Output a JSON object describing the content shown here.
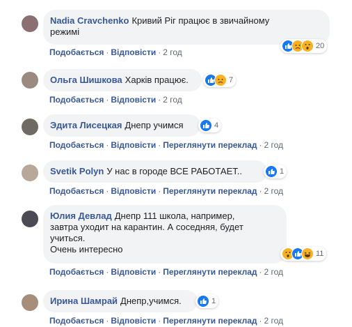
{
  "colors": {
    "link": "#385898",
    "bubble": "#f2f3f5",
    "meta": "#606770",
    "like": "#1877f2",
    "emoji": "#f7b125"
  },
  "actions": {
    "like": "Подобається",
    "reply": "Відповісти",
    "translate": "Переглянути переклад",
    "separator": "·"
  },
  "comments": [
    {
      "author": "Nadia Cravchenko",
      "text_line1": "Кривий Ріг працює в звичайному",
      "text_line2": "режимі",
      "reactions": [
        "like",
        "sad",
        "wow"
      ],
      "count": "20",
      "time": "2 год"
    },
    {
      "author": "Ольга Шишкова",
      "text": "Харків працює.",
      "reactions": [
        "like",
        "sad"
      ],
      "count": "7",
      "time": "2 год"
    },
    {
      "author": "Эдита Лисецкая",
      "text": "Днепр учимся",
      "reactions": [
        "like"
      ],
      "count": "4",
      "time": "2 год"
    },
    {
      "author": "Svetik Polyn",
      "text": "У нас в городе ВСЕ РАБОТАЕТ..",
      "reactions": [
        "like"
      ],
      "count": "1",
      "time": "2 год"
    },
    {
      "author": "Юлия Девлад",
      "text_line1": "Днепр 111 школа, например,",
      "text_line2": "завтра уходит на карантин. А соседняя, будет",
      "text_line3": "учиться.",
      "text_line4": "Очень интересно",
      "reactions": [
        "wow",
        "like",
        "haha"
      ],
      "count": "11",
      "time": "2 год"
    },
    {
      "author": "Ирина Шамрай",
      "text": "Днепр,учимся.",
      "reactions": [
        "like"
      ],
      "count": "1",
      "time": "2 год"
    }
  ]
}
